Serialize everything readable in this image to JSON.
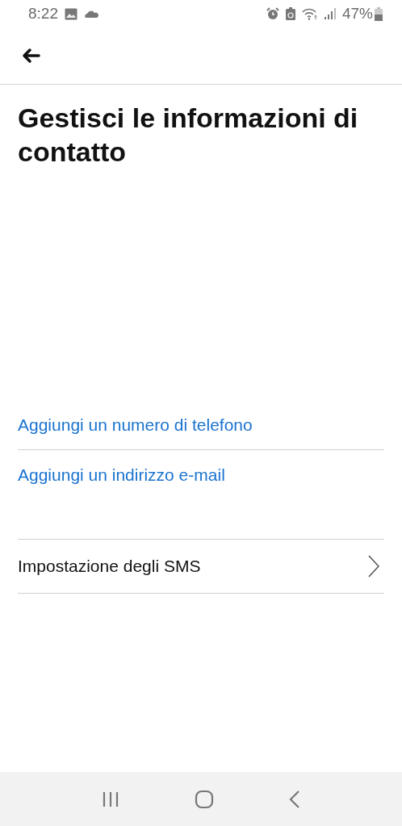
{
  "status_bar": {
    "time": "8:22",
    "battery": "47%"
  },
  "title": "Gestisci le informazioni di contatto",
  "links": [
    {
      "label": "Aggiungi un numero di telefono"
    },
    {
      "label": "Aggiungi un indirizzo e-mail"
    }
  ],
  "settings": [
    {
      "label": "Impostazione degli SMS"
    }
  ]
}
